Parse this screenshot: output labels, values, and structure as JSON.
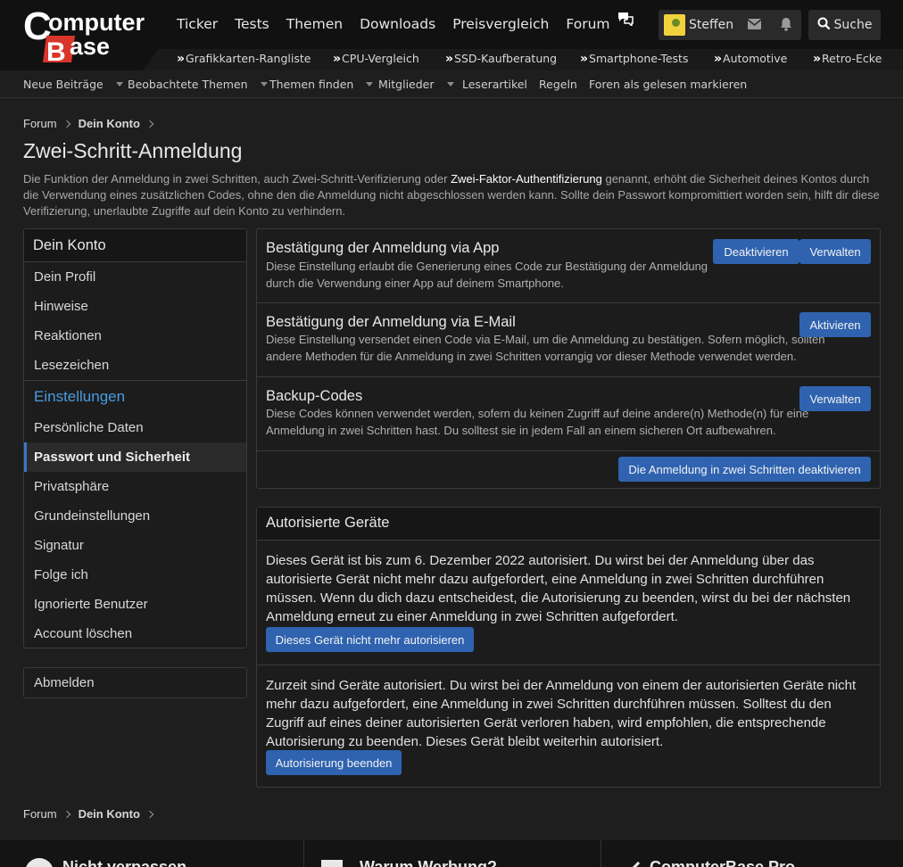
{
  "header": {
    "logo_text": "ComputerBase",
    "nav": [
      "Ticker",
      "Tests",
      "Themen",
      "Downloads",
      "Preisvergleich",
      "Forum"
    ],
    "username": "Steffen",
    "search_label": "Suche"
  },
  "subnav": [
    "Grafikkarten-Rangliste",
    "CPU-Vergleich",
    "SSD-Kaufberatung",
    "Smartphone-Tests",
    "Automotive",
    "Retro-Ecke"
  ],
  "forumnav": [
    "Neue Beiträge",
    "Beobachtete Themen",
    "Themen finden",
    "Mitglieder",
    "Leserartikel",
    "Regeln",
    "Foren als gelesen markieren"
  ],
  "breadcrumb": {
    "forum": "Forum",
    "account": "Dein Konto"
  },
  "page": {
    "title": "Zwei-Schritt-Anmeldung",
    "intro_before": "Die Funktion der Anmeldung in zwei Schritten, auch Zwei-Schritt-Verifizierung oder ",
    "intro_link": "Zwei-Faktor-Authentifizierung",
    "intro_after": " genannt, erhöht die Sicherheit deines Kontos durch die Verwendung eines zusätzlichen Codes, ohne den die Anmeldung nicht abgeschlossen werden kann. Sollte dein Passwort kompromittiert worden sein, hilft dir diese Verifizierung, unerlaubte Zugriffe auf dein Konto zu verhindern."
  },
  "sidebar": {
    "heading": "Dein Konto",
    "items": [
      "Dein Profil",
      "Hinweise",
      "Reaktionen",
      "Lesezeichen"
    ],
    "settings_heading": "Einstellungen",
    "settings": [
      "Persönliche Daten",
      "Passwort und Sicherheit",
      "Privatsphäre",
      "Grundeinstellungen",
      "Signatur",
      "Folge ich",
      "Ignorierte Benutzer",
      "Account löschen"
    ],
    "logout": "Abmelden"
  },
  "methods": [
    {
      "title": "Bestätigung der Anmeldung via App",
      "desc": "Diese Einstellung erlaubt die Generierung eines Code zur Bestätigung der Anmeldung durch die Verwendung einer App auf deinem Smartphone.",
      "buttons": [
        "Deaktivieren",
        "Verwalten"
      ]
    },
    {
      "title": "Bestätigung der Anmeldung via E-Mail",
      "desc": "Diese Einstellung versendet einen Code via E-Mail, um die Anmeldung zu bestätigen. Sofern möglich, sollten andere Methoden für die Anmeldung in zwei Schritten vorrangig vor dieser Methode verwendet werden.",
      "buttons": [
        "Aktivieren"
      ]
    },
    {
      "title": "Backup-Codes",
      "desc": "Diese Codes können verwendet werden, sofern du keinen Zugriff auf deine andere(n) Methode(n) für eine Anmeldung in zwei Schritten hast. Du solltest sie in jedem Fall an einem sicheren Ort aufbewahren.",
      "buttons": [
        "Verwalten"
      ]
    }
  ],
  "disable_all": "Die Anmeldung in zwei Schritten deaktivieren",
  "devices": {
    "heading": "Autorisierte Geräte",
    "this_device_text": "Dieses Gerät ist bis zum 6. Dezember 2022 autorisiert. Du wirst bei der Anmeldung über das autorisierte Gerät nicht mehr dazu aufgefordert, eine Anmeldung in zwei Schritten durchführen müssen. Wenn du dich dazu entscheidest, die Autorisierung zu beenden, wirst du bei der nächsten Anmeldung erneut zu einer Anmeldung in zwei Schritten aufgefordert.",
    "this_device_button": "Dieses Gerät nicht mehr autorisieren",
    "others_text": "Zurzeit sind Geräte autorisiert. Du wirst bei der Anmeldung von einem der autorisierten Geräte nicht mehr dazu aufgefordert, eine Anmeldung in zwei Schritten durchführen müssen. Solltest du den Zugriff auf eines deiner autorisierten Gerät verloren haben, wird empfohlen, die entsprechende Autorisierung zu beenden. Dieses Gerät bleibt weiterhin autorisiert.",
    "others_button": "Autorisierung beenden"
  },
  "footer": [
    "Nicht verpassen",
    "Warum Werbung?",
    "ComputerBase Pro"
  ],
  "colors": {
    "accent": "#2f63b0",
    "link": "#4a9be0",
    "brand_red": "#d9352b"
  }
}
